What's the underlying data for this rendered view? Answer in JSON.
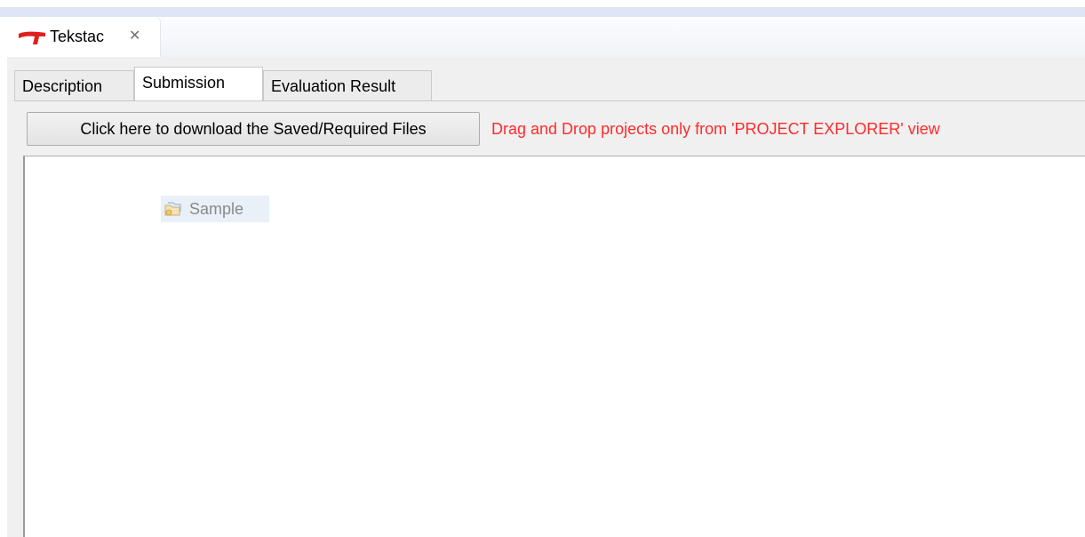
{
  "view": {
    "title": "Tekstac",
    "icon": "tekstac-logo-icon",
    "close_icon": "close-icon"
  },
  "tabs": [
    {
      "label": "Description",
      "selected": false
    },
    {
      "label": "Submission",
      "selected": true
    },
    {
      "label": "Evaluation Result",
      "selected": false
    }
  ],
  "submission": {
    "download_button_label": "Click here to download the Saved/Required Files",
    "drag_notice": "Drag and Drop projects only from 'PROJECT EXPLORER' view",
    "projects": [
      {
        "label": "Sample",
        "icon": "project-folder-icon"
      }
    ]
  },
  "colors": {
    "notice_text": "#ff2b2b",
    "logo_red": "#e0201c",
    "top_band": "#dfe5f4"
  }
}
